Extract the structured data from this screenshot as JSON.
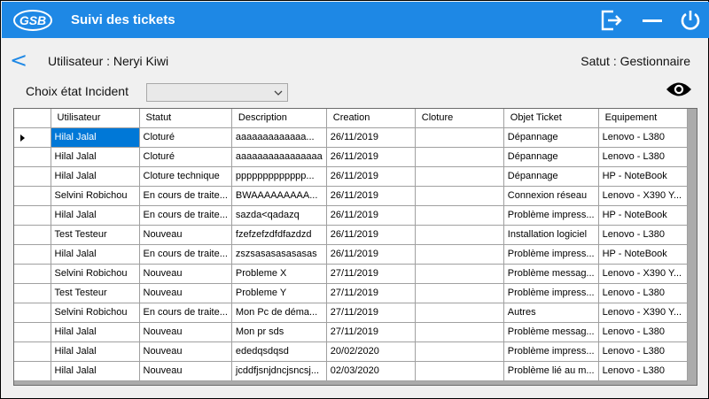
{
  "app": {
    "logo_text": "GSB",
    "title": "Suivi des tickets"
  },
  "user": {
    "label": "Utilisateur : Neryi Kiwi"
  },
  "status": {
    "label": "Satut : Gestionnaire"
  },
  "filter": {
    "label": "Choix état Incident",
    "value": ""
  },
  "grid": {
    "columns": [
      "Utilisateur",
      "Statut",
      "Description",
      "Creation",
      "Cloture",
      "Objet Ticket",
      "Equipement"
    ],
    "current_row": 0,
    "rows": [
      [
        "Hilal Jalal",
        "Cloturé",
        "aaaaaaaaaaaaa...",
        "26/11/2019",
        "",
        "Dépannage",
        "Lenovo - L380"
      ],
      [
        "Hilal Jalal",
        "Cloturé",
        "aaaaaaaaaaaaaaaa",
        "26/11/2019",
        "",
        "Dépannage",
        "Lenovo - L380"
      ],
      [
        "Hilal Jalal",
        "Cloture technique",
        "ppppppppppppp...",
        "26/11/2019",
        "",
        "Dépannage",
        "HP - NoteBook"
      ],
      [
        "Selvini Robichou",
        "En cours de traite...",
        "BWAAAAAAAAA...",
        "26/11/2019",
        "",
        "Connexion réseau",
        "Lenovo - X390 Y..."
      ],
      [
        "Hilal Jalal",
        "En cours de traite...",
        "sazda<qadazq",
        "26/11/2019",
        "",
        "Problème impress...",
        "HP - NoteBook"
      ],
      [
        "Test Testeur",
        "Nouveau",
        "fzefzefzdfdfazdzd",
        "26/11/2019",
        "",
        "Installation logiciel",
        "Lenovo - L380"
      ],
      [
        "Hilal Jalal",
        "En cours de traite...",
        "zszsasasasasasas",
        "26/11/2019",
        "",
        "Problème impress...",
        "HP - NoteBook"
      ],
      [
        "Selvini Robichou",
        "Nouveau",
        "Probleme X",
        "27/11/2019",
        "",
        "Problème messag...",
        "Lenovo - X390 Y..."
      ],
      [
        "Test Testeur",
        "Nouveau",
        "Probleme Y",
        "27/11/2019",
        "",
        "Problème impress...",
        "Lenovo - L380"
      ],
      [
        "Selvini Robichou",
        "En cours de traite...",
        "Mon Pc de déma...",
        "27/11/2019",
        "",
        "Autres",
        "Lenovo - X390 Y..."
      ],
      [
        "Hilal Jalal",
        "Nouveau",
        "Mon pr sds",
        "27/11/2019",
        "",
        "Problème messag...",
        "Lenovo - L380"
      ],
      [
        "Hilal Jalal",
        "Nouveau",
        "ededqsdqsd",
        "20/02/2020",
        "",
        "Problème impress...",
        "Lenovo - L380"
      ],
      [
        "Hilal Jalal",
        "Nouveau",
        "jcddfjsnjdncjsncsj...",
        "02/03/2020",
        "",
        "Problème lié au m...",
        "Lenovo - L380"
      ]
    ]
  },
  "icons": {
    "logout": "logout-icon",
    "minimize": "minimize-icon",
    "power": "power-icon",
    "eye": "eye-icon",
    "back": "back-chevron-icon"
  },
  "colors": {
    "titlebar": "#1e88e5",
    "selection": "#0078d7",
    "accent": "#1e88e5"
  }
}
